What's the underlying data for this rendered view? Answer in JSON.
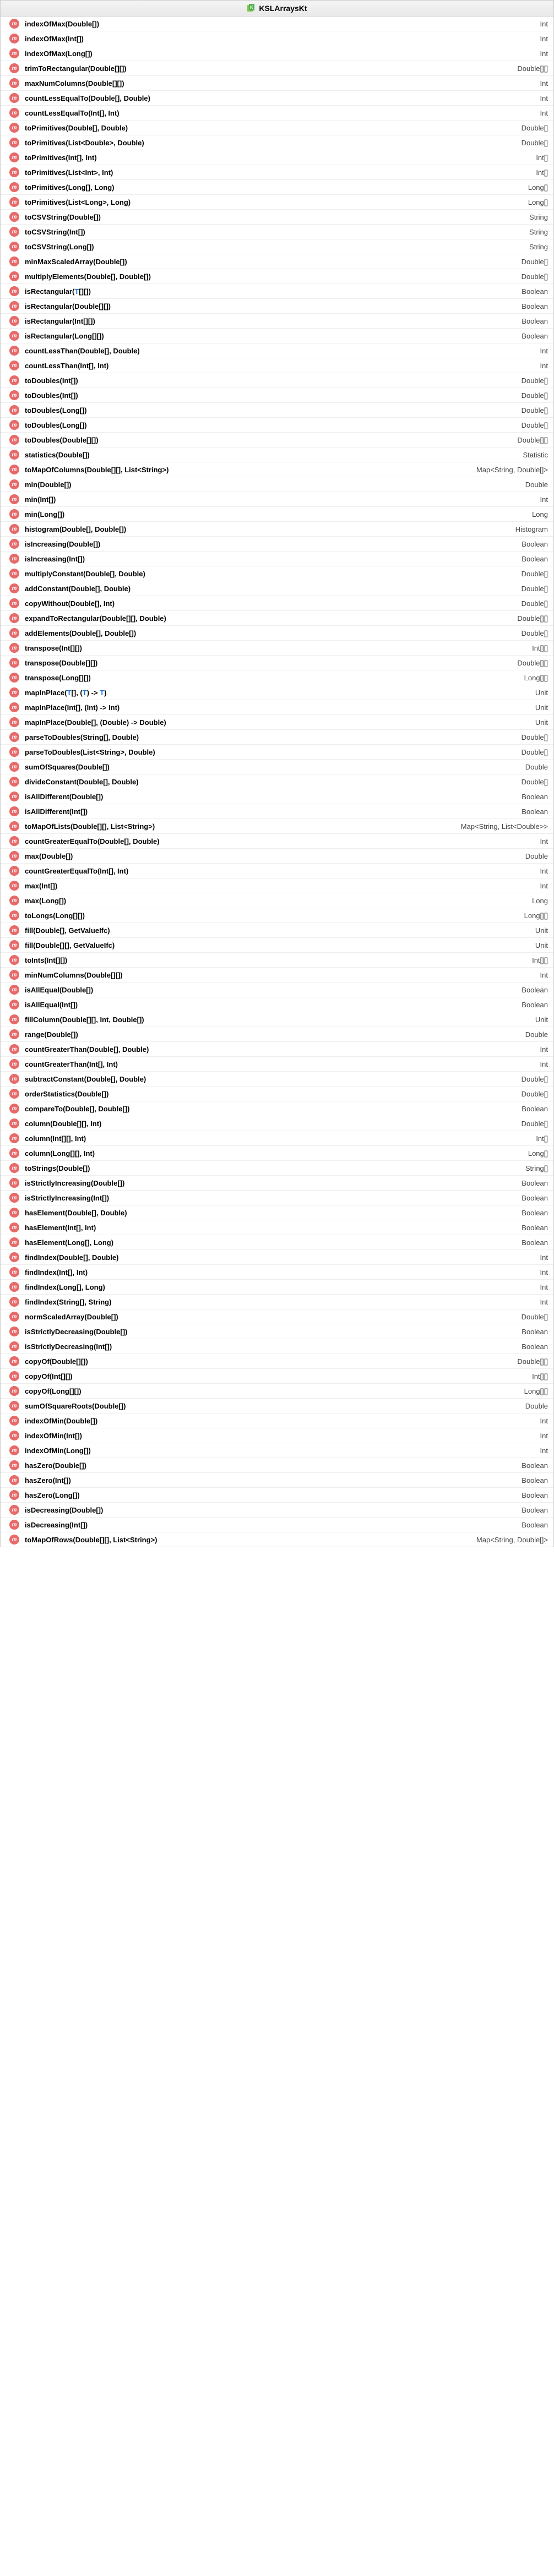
{
  "header": {
    "icon": "class-file-icon",
    "title": "KSLArraysKt"
  },
  "methodIconLetter": "m",
  "methods": [
    {
      "sig_parts": [
        {
          "t": "indexOfMax(Double[])"
        }
      ],
      "ret": "Int"
    },
    {
      "sig_parts": [
        {
          "t": "indexOfMax(Int[])"
        }
      ],
      "ret": "Int"
    },
    {
      "sig_parts": [
        {
          "t": "indexOfMax(Long[])"
        }
      ],
      "ret": "Int"
    },
    {
      "sig_parts": [
        {
          "t": "trimToRectangular(Double[][])"
        }
      ],
      "ret": "Double[][]"
    },
    {
      "sig_parts": [
        {
          "t": "maxNumColumns(Double[][])"
        }
      ],
      "ret": "Int"
    },
    {
      "sig_parts": [
        {
          "t": "countLessEqualTo(Double[], Double)"
        }
      ],
      "ret": "Int"
    },
    {
      "sig_parts": [
        {
          "t": "countLessEqualTo(Int[], Int)"
        }
      ],
      "ret": "Int"
    },
    {
      "sig_parts": [
        {
          "t": "toPrimitives(Double[], Double)"
        }
      ],
      "ret": "Double[]"
    },
    {
      "sig_parts": [
        {
          "t": "toPrimitives(List<Double>, Double)"
        }
      ],
      "ret": "Double[]"
    },
    {
      "sig_parts": [
        {
          "t": "toPrimitives(Int[], Int)"
        }
      ],
      "ret": "Int[]"
    },
    {
      "sig_parts": [
        {
          "t": "toPrimitives(List<Int>, Int)"
        }
      ],
      "ret": "Int[]"
    },
    {
      "sig_parts": [
        {
          "t": "toPrimitives(Long[], Long)"
        }
      ],
      "ret": "Long[]"
    },
    {
      "sig_parts": [
        {
          "t": "toPrimitives(List<Long>, Long)"
        }
      ],
      "ret": "Long[]"
    },
    {
      "sig_parts": [
        {
          "t": "toCSVString(Double[])"
        }
      ],
      "ret": "String"
    },
    {
      "sig_parts": [
        {
          "t": "toCSVString(Int[])"
        }
      ],
      "ret": "String"
    },
    {
      "sig_parts": [
        {
          "t": "toCSVString(Long[])"
        }
      ],
      "ret": "String"
    },
    {
      "sig_parts": [
        {
          "t": "minMaxScaledArray(Double[])"
        }
      ],
      "ret": "Double[]"
    },
    {
      "sig_parts": [
        {
          "t": "multiplyElements(Double[], Double[])"
        }
      ],
      "ret": "Double[]"
    },
    {
      "sig_parts": [
        {
          "t": "isRectangular("
        },
        {
          "t": "T",
          "tp": true
        },
        {
          "t": "[][])"
        }
      ],
      "ret": "Boolean"
    },
    {
      "sig_parts": [
        {
          "t": "isRectangular(Double[][])"
        }
      ],
      "ret": "Boolean"
    },
    {
      "sig_parts": [
        {
          "t": "isRectangular(Int[][])"
        }
      ],
      "ret": "Boolean"
    },
    {
      "sig_parts": [
        {
          "t": "isRectangular(Long[][])"
        }
      ],
      "ret": "Boolean"
    },
    {
      "sig_parts": [
        {
          "t": "countLessThan(Double[], Double)"
        }
      ],
      "ret": "Int"
    },
    {
      "sig_parts": [
        {
          "t": "countLessThan(Int[], Int)"
        }
      ],
      "ret": "Int"
    },
    {
      "sig_parts": [
        {
          "t": "toDoubles(Int[])"
        }
      ],
      "ret": "Double[]"
    },
    {
      "sig_parts": [
        {
          "t": "toDoubles(Int[])"
        }
      ],
      "ret": "Double[]"
    },
    {
      "sig_parts": [
        {
          "t": "toDoubles(Long[])"
        }
      ],
      "ret": "Double[]"
    },
    {
      "sig_parts": [
        {
          "t": "toDoubles(Long[])"
        }
      ],
      "ret": "Double[]"
    },
    {
      "sig_parts": [
        {
          "t": "toDoubles(Double[][])"
        }
      ],
      "ret": "Double[][]"
    },
    {
      "sig_parts": [
        {
          "t": "statistics(Double[])"
        }
      ],
      "ret": "Statistic"
    },
    {
      "sig_parts": [
        {
          "t": "toMapOfColumns(Double[][], List<String>)"
        }
      ],
      "ret": "Map<String, Double[]>"
    },
    {
      "sig_parts": [
        {
          "t": "min(Double[])"
        }
      ],
      "ret": "Double"
    },
    {
      "sig_parts": [
        {
          "t": "min(Int[])"
        }
      ],
      "ret": "Int"
    },
    {
      "sig_parts": [
        {
          "t": "min(Long[])"
        }
      ],
      "ret": "Long"
    },
    {
      "sig_parts": [
        {
          "t": "histogram(Double[], Double[])"
        }
      ],
      "ret": "Histogram"
    },
    {
      "sig_parts": [
        {
          "t": "isIncreasing(Double[])"
        }
      ],
      "ret": "Boolean"
    },
    {
      "sig_parts": [
        {
          "t": "isIncreasing(Int[])"
        }
      ],
      "ret": "Boolean"
    },
    {
      "sig_parts": [
        {
          "t": "multiplyConstant(Double[], Double)"
        }
      ],
      "ret": "Double[]"
    },
    {
      "sig_parts": [
        {
          "t": "addConstant(Double[], Double)"
        }
      ],
      "ret": "Double[]"
    },
    {
      "sig_parts": [
        {
          "t": "copyWithout(Double[], Int)"
        }
      ],
      "ret": "Double[]"
    },
    {
      "sig_parts": [
        {
          "t": "expandToRectangular(Double[][], Double)"
        }
      ],
      "ret": "Double[][]"
    },
    {
      "sig_parts": [
        {
          "t": "addElements(Double[], Double[])"
        }
      ],
      "ret": "Double[]"
    },
    {
      "sig_parts": [
        {
          "t": "transpose(Int[][])"
        }
      ],
      "ret": "Int[][]"
    },
    {
      "sig_parts": [
        {
          "t": "transpose(Double[][])"
        }
      ],
      "ret": "Double[][]"
    },
    {
      "sig_parts": [
        {
          "t": "transpose(Long[][])"
        }
      ],
      "ret": "Long[][]"
    },
    {
      "sig_parts": [
        {
          "t": "mapInPlace("
        },
        {
          "t": "T",
          "tp": true
        },
        {
          "t": "[], ("
        },
        {
          "t": "T",
          "tp": true
        },
        {
          "t": ") -> "
        },
        {
          "t": "T",
          "tp": true
        },
        {
          "t": ")"
        }
      ],
      "ret": "Unit"
    },
    {
      "sig_parts": [
        {
          "t": "mapInPlace(Int[], (Int) -> Int)"
        }
      ],
      "ret": "Unit"
    },
    {
      "sig_parts": [
        {
          "t": "mapInPlace(Double[], (Double) -> Double)"
        }
      ],
      "ret": "Unit"
    },
    {
      "sig_parts": [
        {
          "t": "parseToDoubles(String[], Double)"
        }
      ],
      "ret": "Double[]"
    },
    {
      "sig_parts": [
        {
          "t": "parseToDoubles(List<String>, Double)"
        }
      ],
      "ret": "Double[]"
    },
    {
      "sig_parts": [
        {
          "t": "sumOfSquares(Double[])"
        }
      ],
      "ret": "Double"
    },
    {
      "sig_parts": [
        {
          "t": "divideConstant(Double[], Double)"
        }
      ],
      "ret": "Double[]"
    },
    {
      "sig_parts": [
        {
          "t": "isAllDifferent(Double[])"
        }
      ],
      "ret": "Boolean"
    },
    {
      "sig_parts": [
        {
          "t": "isAllDifferent(Int[])"
        }
      ],
      "ret": "Boolean"
    },
    {
      "sig_parts": [
        {
          "t": "toMapOfLists(Double[][], List<String>)"
        }
      ],
      "ret": "Map<String, List<Double>>"
    },
    {
      "sig_parts": [
        {
          "t": "countGreaterEqualTo(Double[], Double)"
        }
      ],
      "ret": "Int"
    },
    {
      "sig_parts": [
        {
          "t": "max(Double[])"
        }
      ],
      "ret": "Double"
    },
    {
      "sig_parts": [
        {
          "t": "countGreaterEqualTo(Int[], Int)"
        }
      ],
      "ret": "Int"
    },
    {
      "sig_parts": [
        {
          "t": "max(Int[])"
        }
      ],
      "ret": "Int"
    },
    {
      "sig_parts": [
        {
          "t": "max(Long[])"
        }
      ],
      "ret": "Long"
    },
    {
      "sig_parts": [
        {
          "t": "toLongs(Long[][])"
        }
      ],
      "ret": "Long[][]"
    },
    {
      "sig_parts": [
        {
          "t": "fill(Double[], GetValueIfc)"
        }
      ],
      "ret": "Unit"
    },
    {
      "sig_parts": [
        {
          "t": "fill(Double[][], GetValueIfc)"
        }
      ],
      "ret": "Unit"
    },
    {
      "sig_parts": [
        {
          "t": "toInts(Int[][])"
        }
      ],
      "ret": "Int[][]"
    },
    {
      "sig_parts": [
        {
          "t": "minNumColumns(Double[][])"
        }
      ],
      "ret": "Int"
    },
    {
      "sig_parts": [
        {
          "t": "isAllEqual(Double[])"
        }
      ],
      "ret": "Boolean"
    },
    {
      "sig_parts": [
        {
          "t": "isAllEqual(Int[])"
        }
      ],
      "ret": "Boolean"
    },
    {
      "sig_parts": [
        {
          "t": "fillColumn(Double[][], Int, Double[])"
        }
      ],
      "ret": "Unit"
    },
    {
      "sig_parts": [
        {
          "t": "range(Double[])"
        }
      ],
      "ret": "Double"
    },
    {
      "sig_parts": [
        {
          "t": "countGreaterThan(Double[], Double)"
        }
      ],
      "ret": "Int"
    },
    {
      "sig_parts": [
        {
          "t": "countGreaterThan(Int[], Int)"
        }
      ],
      "ret": "Int"
    },
    {
      "sig_parts": [
        {
          "t": "subtractConstant(Double[], Double)"
        }
      ],
      "ret": "Double[]"
    },
    {
      "sig_parts": [
        {
          "t": "orderStatistics(Double[])"
        }
      ],
      "ret": "Double[]"
    },
    {
      "sig_parts": [
        {
          "t": "compareTo(Double[], Double[])"
        }
      ],
      "ret": "Boolean"
    },
    {
      "sig_parts": [
        {
          "t": "column(Double[][], Int)"
        }
      ],
      "ret": "Double[]"
    },
    {
      "sig_parts": [
        {
          "t": "column(Int[][], Int)"
        }
      ],
      "ret": "Int[]"
    },
    {
      "sig_parts": [
        {
          "t": "column(Long[][], Int)"
        }
      ],
      "ret": "Long[]"
    },
    {
      "sig_parts": [
        {
          "t": "toStrings(Double[])"
        }
      ],
      "ret": "String[]"
    },
    {
      "sig_parts": [
        {
          "t": "isStrictlyIncreasing(Double[])"
        }
      ],
      "ret": "Boolean"
    },
    {
      "sig_parts": [
        {
          "t": "isStrictlyIncreasing(Int[])"
        }
      ],
      "ret": "Boolean"
    },
    {
      "sig_parts": [
        {
          "t": "hasElement(Double[], Double)"
        }
      ],
      "ret": "Boolean"
    },
    {
      "sig_parts": [
        {
          "t": "hasElement(Int[], Int)"
        }
      ],
      "ret": "Boolean"
    },
    {
      "sig_parts": [
        {
          "t": "hasElement(Long[], Long)"
        }
      ],
      "ret": "Boolean"
    },
    {
      "sig_parts": [
        {
          "t": "findIndex(Double[], Double)"
        }
      ],
      "ret": "Int"
    },
    {
      "sig_parts": [
        {
          "t": "findIndex(Int[], Int)"
        }
      ],
      "ret": "Int"
    },
    {
      "sig_parts": [
        {
          "t": "findIndex(Long[], Long)"
        }
      ],
      "ret": "Int"
    },
    {
      "sig_parts": [
        {
          "t": "findIndex(String[], String)"
        }
      ],
      "ret": "Int"
    },
    {
      "sig_parts": [
        {
          "t": "normScaledArray(Double[])"
        }
      ],
      "ret": "Double[]"
    },
    {
      "sig_parts": [
        {
          "t": "isStrictlyDecreasing(Double[])"
        }
      ],
      "ret": "Boolean"
    },
    {
      "sig_parts": [
        {
          "t": "isStrictlyDecreasing(Int[])"
        }
      ],
      "ret": "Boolean"
    },
    {
      "sig_parts": [
        {
          "t": "copyOf(Double[][])"
        }
      ],
      "ret": "Double[][]"
    },
    {
      "sig_parts": [
        {
          "t": "copyOf(Int[][])"
        }
      ],
      "ret": "Int[][]"
    },
    {
      "sig_parts": [
        {
          "t": "copyOf(Long[][])"
        }
      ],
      "ret": "Long[][]"
    },
    {
      "sig_parts": [
        {
          "t": "sumOfSquareRoots(Double[])"
        }
      ],
      "ret": "Double"
    },
    {
      "sig_parts": [
        {
          "t": "indexOfMin(Double[])"
        }
      ],
      "ret": "Int"
    },
    {
      "sig_parts": [
        {
          "t": "indexOfMin(Int[])"
        }
      ],
      "ret": "Int"
    },
    {
      "sig_parts": [
        {
          "t": "indexOfMin(Long[])"
        }
      ],
      "ret": "Int"
    },
    {
      "sig_parts": [
        {
          "t": "hasZero(Double[])"
        }
      ],
      "ret": "Boolean"
    },
    {
      "sig_parts": [
        {
          "t": "hasZero(Int[])"
        }
      ],
      "ret": "Boolean"
    },
    {
      "sig_parts": [
        {
          "t": "hasZero(Long[])"
        }
      ],
      "ret": "Boolean"
    },
    {
      "sig_parts": [
        {
          "t": "isDecreasing(Double[])"
        }
      ],
      "ret": "Boolean"
    },
    {
      "sig_parts": [
        {
          "t": "isDecreasing(Int[])"
        }
      ],
      "ret": "Boolean"
    },
    {
      "sig_parts": [
        {
          "t": "toMapOfRows(Double[][], List<String>)"
        }
      ],
      "ret": "Map<String, Double[]>"
    }
  ]
}
